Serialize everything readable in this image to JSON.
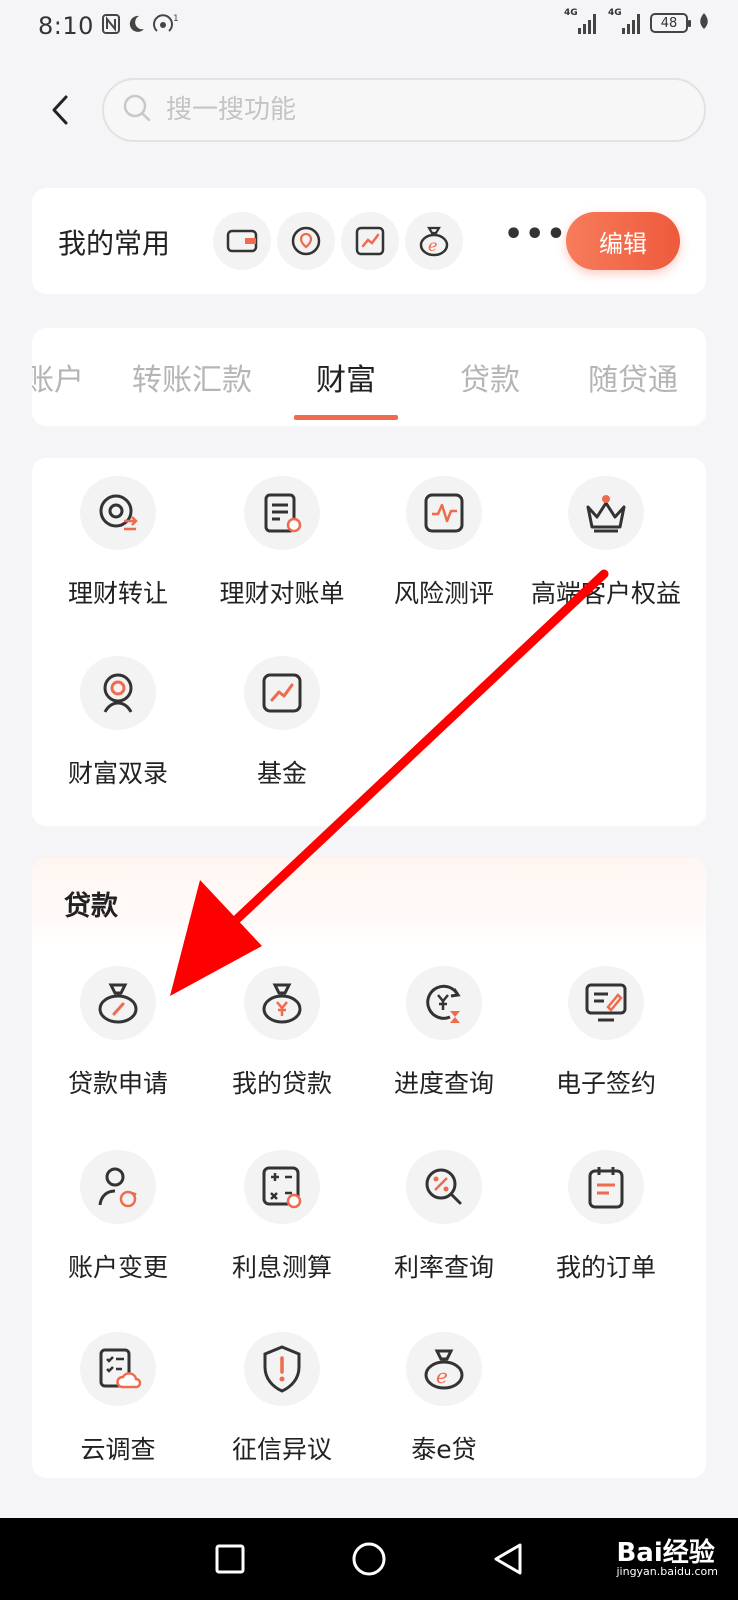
{
  "status": {
    "time": "8:10",
    "net1": "4G",
    "net2": "4G",
    "battery": "48"
  },
  "search": {
    "placeholder": "搜一搜功能"
  },
  "favorites": {
    "title": "我的常用",
    "icons": [
      "card-icon",
      "location-pin-icon",
      "chart-trend-icon",
      "money-bag-icon"
    ],
    "more_label": "•••",
    "edit_label": "编辑"
  },
  "tabs": {
    "items": [
      "账户",
      "转账汇款",
      "财富",
      "贷款",
      "随贷通"
    ],
    "active": "财富"
  },
  "wealth": {
    "items": [
      {
        "label": "理财转让",
        "icon": "transfer-icon"
      },
      {
        "label": "理财对账单",
        "icon": "statement-icon"
      },
      {
        "label": "风险测评",
        "icon": "risk-chart-icon"
      },
      {
        "label": "高端客户权益",
        "icon": "crown-icon"
      },
      {
        "label": "财富双录",
        "icon": "camera-record-icon"
      },
      {
        "label": "基金",
        "icon": "fund-icon"
      }
    ]
  },
  "loans": {
    "title": "贷款",
    "items": [
      {
        "label": "贷款申请",
        "icon": "loan-bag-icon"
      },
      {
        "label": "我的贷款",
        "icon": "yuan-bag-icon"
      },
      {
        "label": "进度查询",
        "icon": "progress-icon"
      },
      {
        "label": "电子签约",
        "icon": "e-sign-icon"
      },
      {
        "label": "账户变更",
        "icon": "user-refresh-icon"
      },
      {
        "label": "利息测算",
        "icon": "calculator-icon"
      },
      {
        "label": "利率查询",
        "icon": "rate-search-icon"
      },
      {
        "label": "我的订单",
        "icon": "order-icon"
      },
      {
        "label": "云调查",
        "icon": "cloud-survey-icon"
      },
      {
        "label": "征信异议",
        "icon": "shield-alert-icon"
      },
      {
        "label": "泰e贷",
        "icon": "e-loan-icon"
      }
    ]
  },
  "watermark": {
    "brand": "Bai经验",
    "url": "jingyan.baidu.com"
  },
  "colors": {
    "accent": "#ef6b4d",
    "annotation": "#ff0000"
  }
}
